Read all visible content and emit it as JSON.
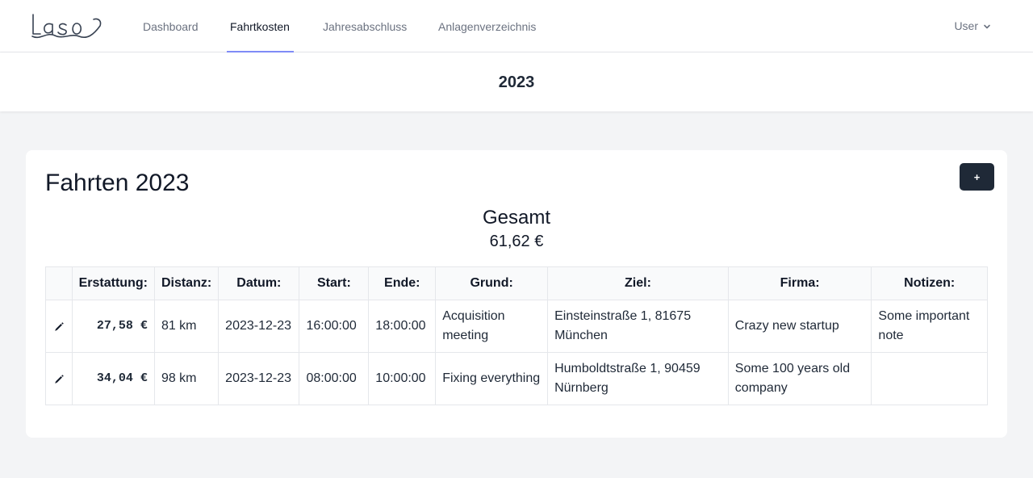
{
  "brand": {
    "logo_text": "Laso"
  },
  "nav": {
    "items": [
      {
        "label": "Dashboard",
        "active": false
      },
      {
        "label": "Fahrtkosten",
        "active": true
      },
      {
        "label": "Jahresabschluss",
        "active": false
      },
      {
        "label": "Anlagenverzeichnis",
        "active": false
      }
    ],
    "user_label": "User",
    "accent_color": "#818cf8"
  },
  "header": {
    "year": "2023"
  },
  "card": {
    "title": "Fahrten 2023",
    "add_label": "+",
    "total_label": "Gesamt",
    "total_value": "61,62 €"
  },
  "table": {
    "headers": [
      "",
      "Erstattung:",
      "Distanz:",
      "Datum:",
      "Start:",
      "Ende:",
      "Grund:",
      "Ziel:",
      "Firma:",
      "Notizen:"
    ],
    "rows": [
      {
        "icon": "pencil-icon",
        "erstattung": "27,58 €",
        "distanz": "81 km",
        "datum": "2023-12-23",
        "start": "16:00:00",
        "ende": "18:00:00",
        "grund": "Acquisition meeting",
        "ziel": "Einsteinstraße 1, 81675 München",
        "firma": "Crazy new startup",
        "notizen": "Some important note"
      },
      {
        "icon": "pencil-icon",
        "erstattung": "34,04 €",
        "distanz": "98 km",
        "datum": "2023-12-23",
        "start": "08:00:00",
        "ende": "10:00:00",
        "grund": "Fixing everything",
        "ziel": "Humboldtstraße 1, 90459 Nürnberg",
        "firma": "Some 100 years old company",
        "notizen": ""
      }
    ]
  }
}
